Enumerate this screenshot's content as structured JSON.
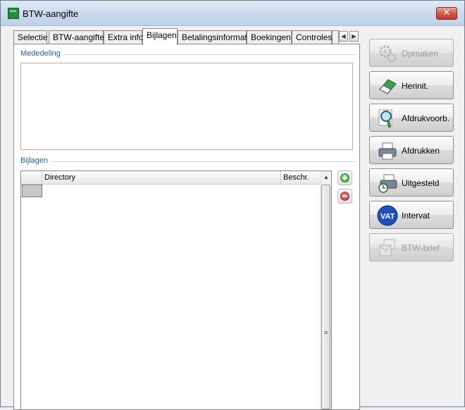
{
  "window": {
    "title": "BTW-aangifte",
    "app_icon_text": "BOK"
  },
  "tabs": [
    {
      "label": "Selectie",
      "active": false
    },
    {
      "label": "BTW-aangifte",
      "active": false
    },
    {
      "label": "Extra info",
      "active": false
    },
    {
      "label": "Bijlagen",
      "active": true
    },
    {
      "label": "Betalingsinformatie",
      "active": false
    },
    {
      "label": "Boekingen",
      "active": false
    },
    {
      "label": "Controles",
      "active": false
    }
  ],
  "panel": {
    "memo_group_label": "Mededeling",
    "memo_value": "",
    "attachments_group_label": "Bijlagen",
    "grid": {
      "columns": [
        "",
        "Directory",
        "Beschr."
      ],
      "rows": [
        {
          "selector": "",
          "directory": "",
          "description": ""
        }
      ]
    }
  },
  "actions": [
    {
      "label": "Opmaken",
      "icon": "gears-icon",
      "enabled": false
    },
    {
      "label": "Herinit.",
      "icon": "eraser-icon",
      "enabled": true
    },
    {
      "label": "Afdrukvoorb.",
      "icon": "magnifier-icon",
      "enabled": true
    },
    {
      "label": "Afdrukken",
      "icon": "printer-icon",
      "enabled": true
    },
    {
      "label": "Uitgesteld",
      "icon": "printer-clock-icon",
      "enabled": true
    },
    {
      "label": "Intervat",
      "icon": "vat-icon",
      "enabled": true
    },
    {
      "label": "BTW-brief",
      "icon": "letters-icon",
      "enabled": false
    }
  ],
  "colors": {
    "group_label": "#1e5fb3",
    "add_button": "#2e9e2e",
    "remove_button": "#c62828",
    "vat_badge": "#1f4fbf"
  }
}
